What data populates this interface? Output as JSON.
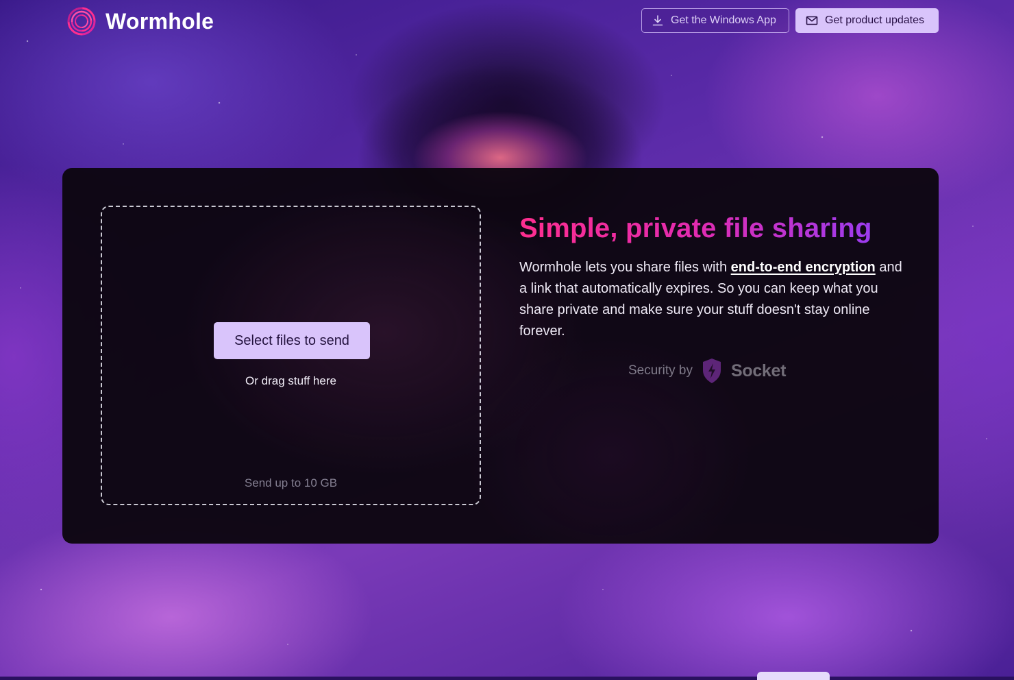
{
  "header": {
    "logo_text": "Wormhole",
    "windows_app_label": "Get the Windows App",
    "updates_label": "Get product updates"
  },
  "upload": {
    "select_label": "Select files to send",
    "drag_text": "Or drag stuff here",
    "limit_text": "Send up to 10 GB"
  },
  "hero": {
    "headline": "Simple, private file sharing",
    "desc_prefix": "Wormhole lets you share files with ",
    "desc_link": "end-to-end encryption",
    "desc_suffix": " and a link that automatically expires. So you can keep what you share private and make sure your stuff doesn't stay online forever."
  },
  "security": {
    "label": "Security by",
    "brand": "Socket"
  },
  "icons": {
    "logo": "wormhole-swirl-icon",
    "windows": "download-icon",
    "updates": "mail-icon",
    "security": "socket-shield-icon"
  },
  "colors": {
    "accent": "#d9c4fb",
    "headline_start": "#ff2e8f",
    "headline_end": "#9b3cf0",
    "card_bg": "#0c0610"
  }
}
